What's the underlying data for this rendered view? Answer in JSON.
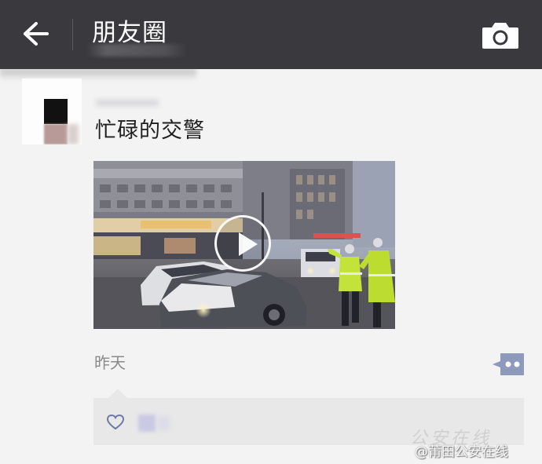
{
  "header": {
    "title": "朋友圈",
    "back_icon": "arrow-left-icon",
    "camera_icon": "camera-icon"
  },
  "post": {
    "text": "忙碌的交警",
    "video_icon": "play-icon",
    "time": "昨天",
    "comment_icon": "comment-dots-icon",
    "like_icon": "heart-icon"
  },
  "watermark": {
    "logo": "公安在线",
    "handle": "@莆田公安在线"
  },
  "colors": {
    "header_bg": "#3a3a3e",
    "page_bg": "#f3f3f3",
    "comment_button": "#8d9abc",
    "likes_bg": "#e8e8e8"
  }
}
